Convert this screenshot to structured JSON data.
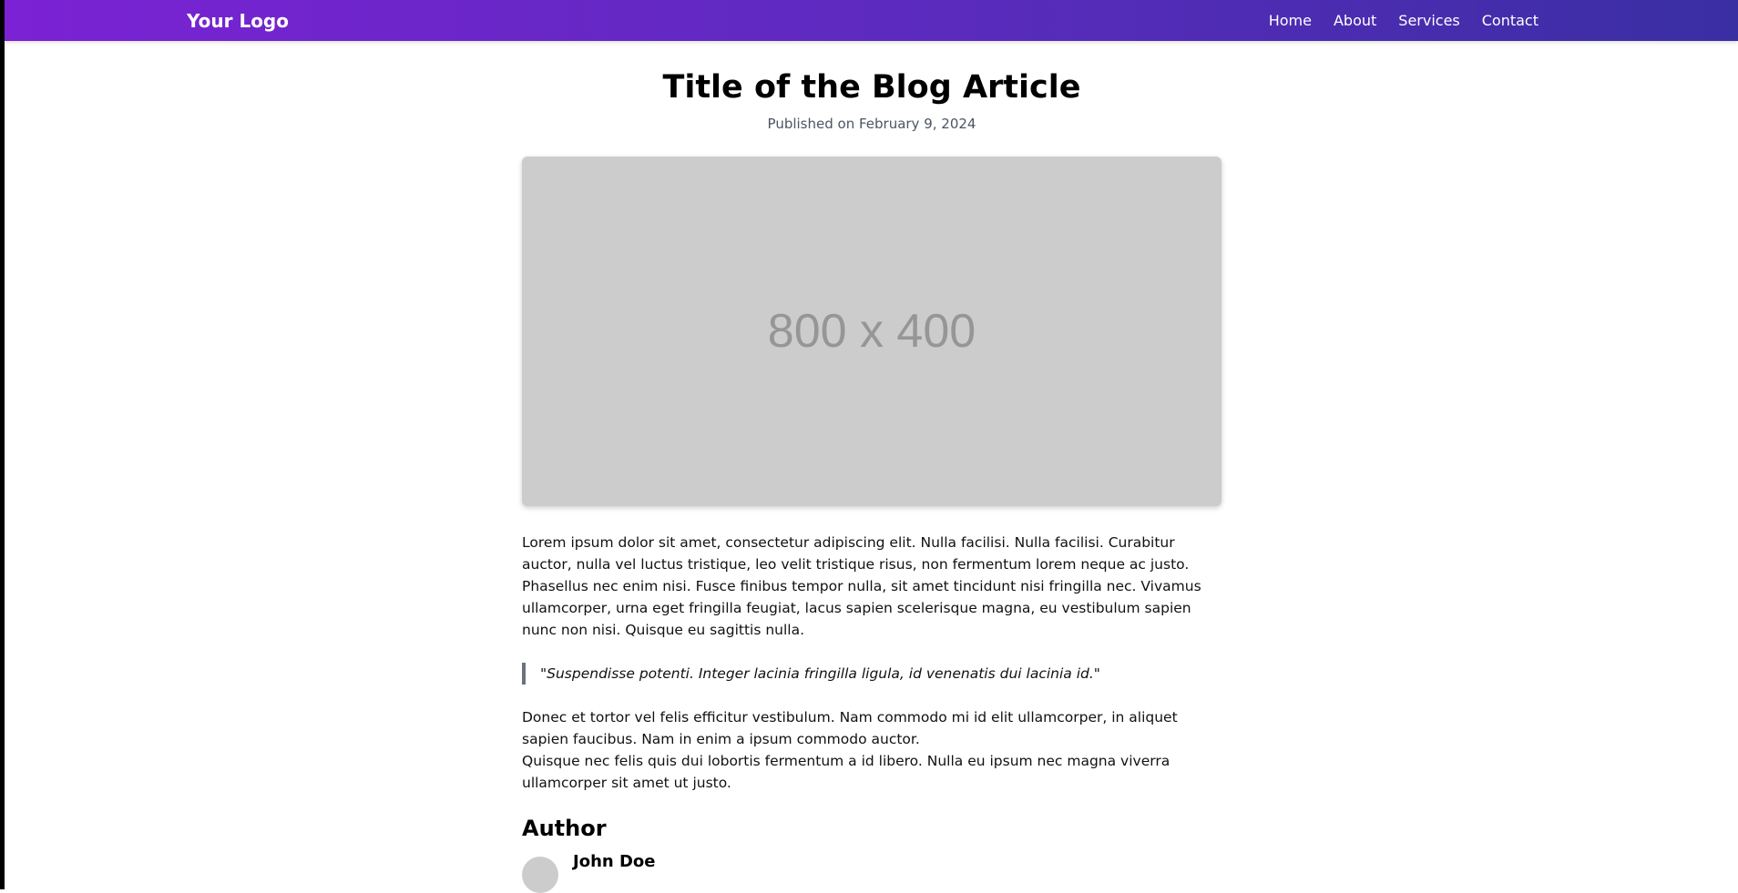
{
  "header": {
    "logo": "Your Logo",
    "nav": [
      "Home",
      "About",
      "Services",
      "Contact"
    ]
  },
  "article": {
    "title": "Title of the Blog Article",
    "date": "Published on February 9, 2024",
    "image_placeholder": "800 x 400",
    "paragraphs_1": [
      "Lorem ipsum dolor sit amet, consectetur adipiscing elit. Nulla facilisi. Nulla facilisi. Curabitur auctor, nulla vel luctus tristique, leo velit tristique risus, non fermentum lorem neque ac justo.",
      "Phasellus nec enim nisi. Fusce finibus tempor nulla, sit amet tincidunt nisi fringilla nec. Vivamus ullamcorper, urna eget fringilla feugiat, lacus sapien scelerisque magna, eu vestibulum sapien nunc non nisi. Quisque eu sagittis nulla."
    ],
    "quote": "\"Suspendisse potenti. Integer lacinia fringilla ligula, id venenatis dui lacinia id.\"",
    "paragraphs_2": [
      "Donec et tortor vel felis efficitur vestibulum. Nam commodo mi id elit ullamcorper, in aliquet sapien faucibus. Nam in enim a ipsum commodo auctor.",
      "Quisque nec felis quis dui lobortis fermentum a id libero. Nulla eu ipsum nec magna viverra ullamcorper sit amet ut justo."
    ],
    "author_heading": "Author",
    "author_name": "John Doe"
  }
}
